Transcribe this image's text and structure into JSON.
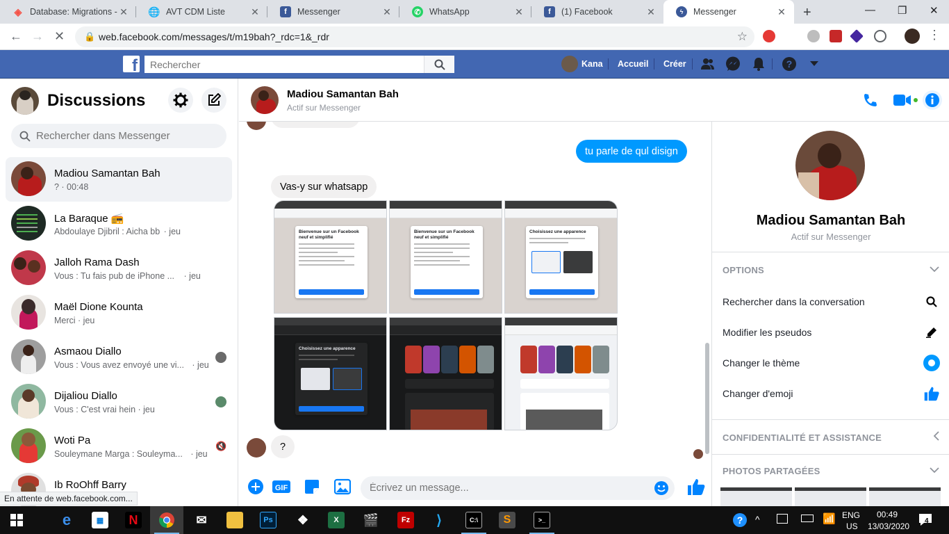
{
  "browser": {
    "tabs": [
      {
        "title": "Database: Migrations -",
        "icon": "laravel-icon",
        "color": "#f55247"
      },
      {
        "title": "AVT CDM Liste",
        "icon": "globe-icon",
        "color": "#5f6368"
      },
      {
        "title": "Messenger",
        "icon": "facebook-icon",
        "color": "#3b5998"
      },
      {
        "title": "WhatsApp",
        "icon": "whatsapp-icon",
        "color": "#25d366"
      },
      {
        "title": "(1) Facebook",
        "icon": "facebook-icon",
        "color": "#3b5998"
      },
      {
        "title": "Messenger",
        "icon": "messenger-icon",
        "color": "#3b5998"
      }
    ],
    "url": "web.facebook.com/messages/t/m19bah?_rdc=1&_rdr",
    "status_text": "En attente de web.facebook.com..."
  },
  "fb_header": {
    "search_placeholder": "Rechercher",
    "user_name": "Kana",
    "home_label": "Accueil",
    "create_label": "Créer"
  },
  "sidebar": {
    "title": "Discussions",
    "search_placeholder": "Rechercher dans Messenger",
    "conversations": [
      {
        "name": "Madiou Samantan Bah",
        "preview": "? · 00:48",
        "time": "",
        "selected": true,
        "avatar_color": "#7a4a3a"
      },
      {
        "name": "La Baraque 📻",
        "preview": "Abdoulaye Djibril : Aicha bb",
        "time": "· jeu",
        "avatar_color": "#1e2a24"
      },
      {
        "name": "Jalloh Rama Dash",
        "preview": "Vous : Tu fais pub de iPhone ...",
        "time": "· jeu",
        "avatar_color": "#c0384a"
      },
      {
        "name": "Maël Dione Kounta",
        "preview": "Merci · jeu",
        "time": "",
        "avatar_color": "#3a2a2a"
      },
      {
        "name": "Asmaou Diallo",
        "preview": "Vous : Vous avez envoyé une vi...",
        "time": "· jeu",
        "avatar_color": "#6a6a6a"
      },
      {
        "name": "Dijaliou Diallo",
        "preview": "Vous : C'est vrai hein · jeu",
        "time": "",
        "avatar_color": "#5a8a6a"
      },
      {
        "name": "Woti Pa",
        "preview": "Souleymane Marga : Souleyma...",
        "time": "· jeu",
        "avatar_color": "#8a5a3a"
      },
      {
        "name": "Ib RoOhff Barry",
        "preview": "",
        "time": "",
        "avatar_color": "#b03a2a"
      }
    ]
  },
  "chat": {
    "contact_name": "Madiou Samantan Bah",
    "contact_status": "Actif sur Messenger",
    "messages": {
      "outgoing_1": "tu parle de qul disign",
      "incoming_1": "Vas-y sur whatsapp",
      "incoming_2": "?"
    },
    "shots": {
      "welcome_title": "Bienvenue sur un Facebook neuf et simplifié",
      "theme_title": "Choisissez une apparence",
      "button_label": "Suivant",
      "start_label": "Commencer"
    },
    "composer_placeholder": "Écrivez un message..."
  },
  "info_panel": {
    "name": "Madiou Samantan Bah",
    "status": "Actif sur Messenger",
    "options_header": "OPTIONS",
    "options": [
      {
        "label": "Rechercher dans la conversation",
        "icon": "search-icon"
      },
      {
        "label": "Modifier les pseudos",
        "icon": "pencil-icon"
      },
      {
        "label": "Changer le thème",
        "icon": "theme-icon"
      },
      {
        "label": "Changer d'emoji",
        "icon": "thumbs-up-icon"
      }
    ],
    "privacy_header": "CONFIDENTIALITÉ ET ASSISTANCE",
    "photos_header": "PHOTOS PARTAGÉES"
  },
  "taskbar": {
    "language": "ENG",
    "region": "US",
    "time": "00:49",
    "date": "13/03/2020",
    "notification_count": "4"
  },
  "colors": {
    "fb_blue": "#4267b2",
    "messenger_blue": "#0099ff",
    "accent": "#0084ff"
  }
}
